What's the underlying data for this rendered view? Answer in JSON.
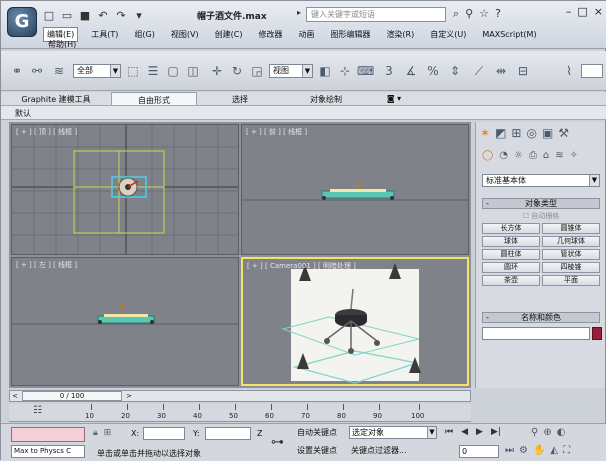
{
  "title": {
    "document": "帽子酒文件.max",
    "search_placeholder": "键入关键字或短语",
    "logo_letter": "G"
  },
  "menu": {
    "items": [
      "编辑(E)",
      "工具(T)",
      "组(G)",
      "视图(V)",
      "创建(C)",
      "修改器",
      "动画",
      "图形编辑器",
      "渲染(R)",
      "自定义(U)",
      "MAXScript(M)"
    ],
    "help": "帮助(H)"
  },
  "toolbar": {
    "filter_value": "全部",
    "view_value": "视图"
  },
  "ribbon": {
    "tabs": [
      "Graphite 建模工具",
      "自由形式",
      "选择",
      "对象绘制"
    ],
    "sub_label": "默认"
  },
  "viewports": {
    "top_label": "[ + ] [ 顶 ] [ 线框 ]",
    "front_label": "[ + ] [ 前 ] [ 线框 ]",
    "left_label": "[ + ] [ 左 ] [ 线框 ]",
    "camera_label": "[ + ] [ Camera001 ] [ 明暗处理 ]"
  },
  "command_panel": {
    "category_value": "标准基本体",
    "object_type_header": "对象类型",
    "autogrid_label": "自动栅格",
    "primitives": [
      "长方体",
      "圆锥体",
      "球体",
      "几何球体",
      "圆柱体",
      "管状体",
      "圆环",
      "四棱锥",
      "茶壶",
      "平面"
    ],
    "name_color_header": "名称和颜色"
  },
  "timeline": {
    "position": "0 / 100",
    "ticks": [
      "10",
      "20",
      "30",
      "40",
      "50",
      "60",
      "70",
      "80",
      "90",
      "100"
    ]
  },
  "status": {
    "maxscript_output": "Max to Physcs C",
    "x_label": "X:",
    "y_label": "Y:",
    "z_label": "Z",
    "prompt": "单击或单击并拖动以选择对象",
    "autokey_label": "自动关键点",
    "setkey_label": "设置关键点",
    "selection_value": "选定对象",
    "keyfilter_label": "关键点过滤器...",
    "frame_value": "0"
  }
}
